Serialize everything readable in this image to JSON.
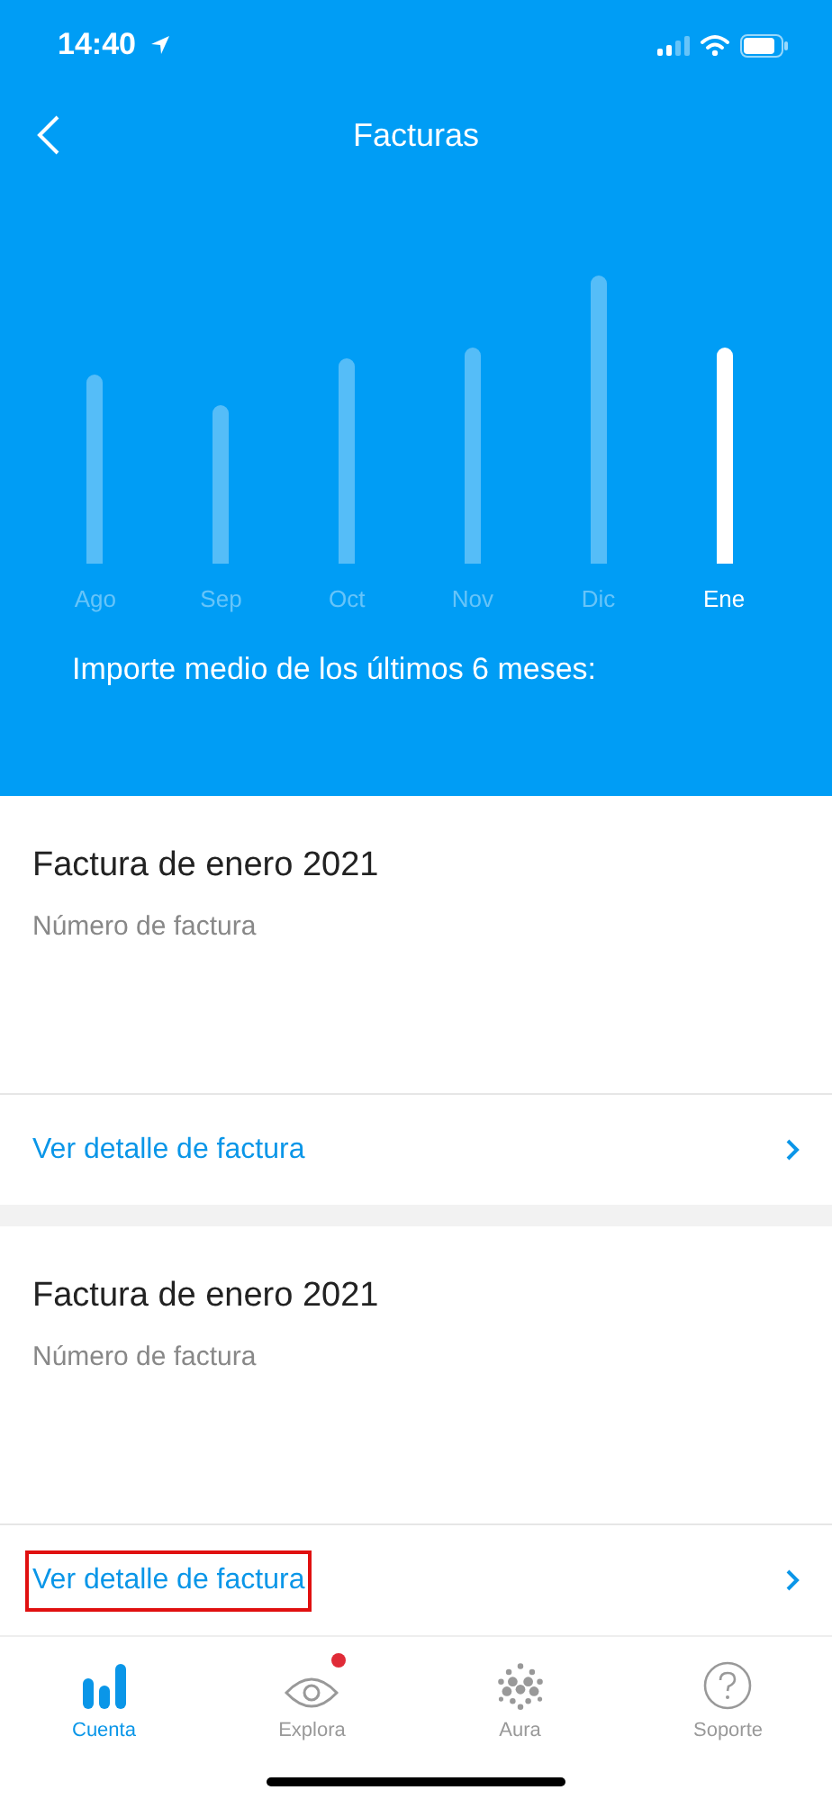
{
  "status_bar": {
    "time": "14:40"
  },
  "header": {
    "title": "Facturas"
  },
  "months": [
    {
      "label": "Ago",
      "selected": false
    },
    {
      "label": "Sep",
      "selected": false
    },
    {
      "label": "Oct",
      "selected": false
    },
    {
      "label": "Nov",
      "selected": false
    },
    {
      "label": "Dic",
      "selected": false
    },
    {
      "label": "Ene",
      "selected": true
    }
  ],
  "average_label": "Importe medio de los últimos 6 meses:",
  "invoices": [
    {
      "title": "Factura de enero 2021",
      "subtitle": "Número de factura",
      "link": "Ver detalle de factura",
      "highlighted": false
    },
    {
      "title": "Factura de enero 2021",
      "subtitle": "Número de factura",
      "link": "Ver detalle de factura",
      "highlighted": true
    }
  ],
  "tabs": [
    {
      "label": "Cuenta",
      "kind": "bars",
      "selected": true,
      "badge": false
    },
    {
      "label": "Explora",
      "kind": "eye",
      "selected": false,
      "badge": true
    },
    {
      "label": "Aura",
      "kind": "dots",
      "selected": false,
      "badge": false
    },
    {
      "label": "Soporte",
      "kind": "help",
      "selected": false,
      "badge": false
    }
  ]
}
